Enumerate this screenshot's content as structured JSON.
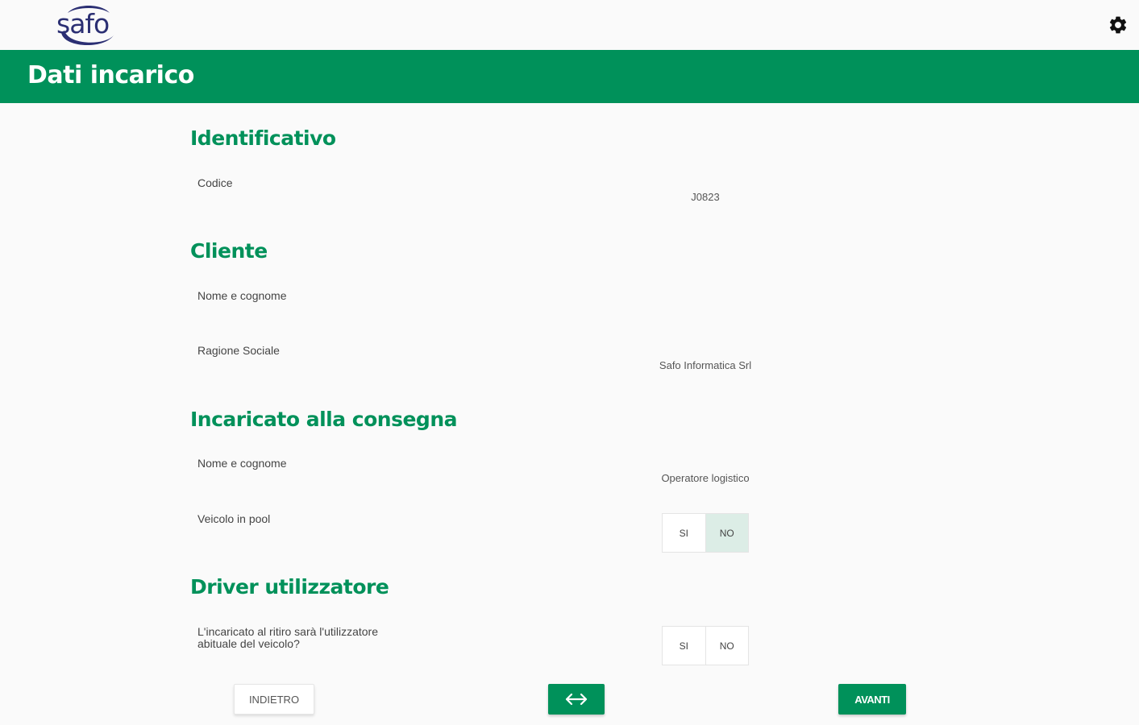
{
  "header": {
    "logo_text": "safo",
    "settings_icon": "gear-icon",
    "page_title": "Dati incarico"
  },
  "sections": {
    "identificativo": {
      "title": "Identificativo",
      "codice_label": "Codice",
      "codice_value": "J0823"
    },
    "cliente": {
      "title": "Cliente",
      "nome_label": "Nome e cognome",
      "nome_value": "",
      "ragione_label": "Ragione Sociale",
      "ragione_value": "Safo Informatica Srl"
    },
    "incaricato": {
      "title": "Incaricato alla consegna",
      "nome_label": "Nome e cognome",
      "nome_value": "Operatore logistico",
      "pool_label": "Veicolo in pool",
      "pool_options": [
        "SI",
        "NO"
      ],
      "pool_selected": "NO"
    },
    "driver": {
      "title": "Driver utilizzatore",
      "question_line1": "L'incaricato al ritiro sarà l'utilizzatore",
      "question_line2": "abituale del veicolo?",
      "options": [
        "SI",
        "NO"
      ],
      "selected": ""
    }
  },
  "footer": {
    "back_label": "INDIETRO",
    "swap_icon": "swap-arrows-icon",
    "next_label": "AVANTI"
  },
  "colors": {
    "brand_green": "#00915a",
    "logo_blue": "#2b2f73",
    "selected_bg": "#dcede6"
  }
}
